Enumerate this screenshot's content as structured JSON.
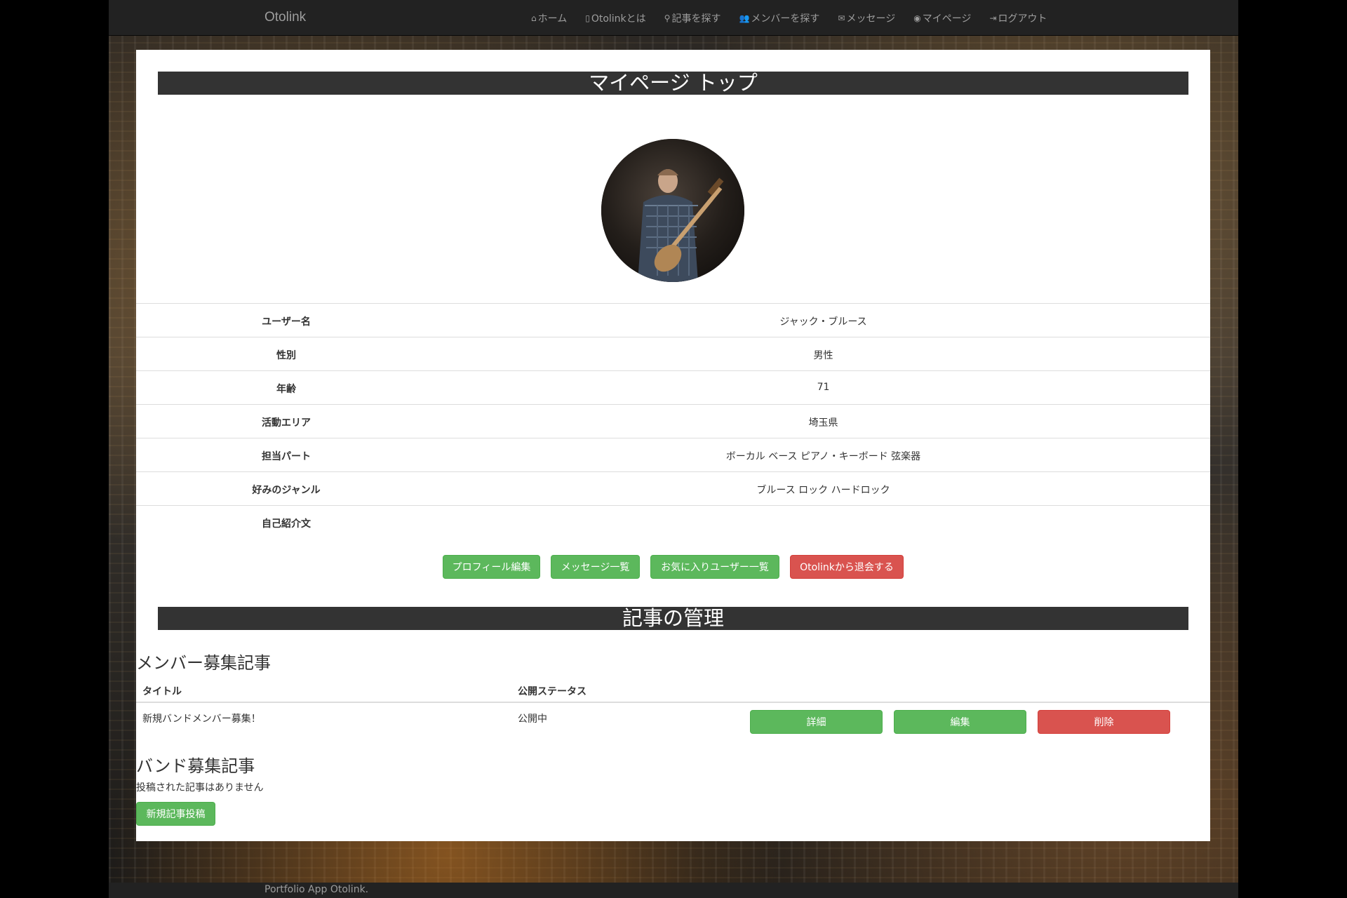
{
  "navbar": {
    "brand": "Otolink",
    "items": [
      {
        "icon": "home-icon",
        "glyph": "⌂",
        "label": "ホーム"
      },
      {
        "icon": "file-icon",
        "glyph": "▯",
        "label": "Otolinkとは"
      },
      {
        "icon": "search-icon",
        "glyph": "⚲",
        "label": "記事を探す"
      },
      {
        "icon": "users-icon",
        "glyph": "👥",
        "label": "メンバーを探す"
      },
      {
        "icon": "envelope-icon",
        "glyph": "✉",
        "label": "メッセージ"
      },
      {
        "icon": "user-circle-icon",
        "glyph": "◉",
        "label": "マイページ"
      },
      {
        "icon": "logout-icon",
        "glyph": "⇥",
        "label": "ログアウト"
      }
    ]
  },
  "mypage": {
    "title": "マイページ トップ",
    "avatar_icon": "user-photo-bass-player",
    "profile": [
      {
        "key": "ユーザー名",
        "value": "ジャック・ブルース"
      },
      {
        "key": "性別",
        "value": "男性"
      },
      {
        "key": "年齢",
        "value": "71"
      },
      {
        "key": "活動エリア",
        "value": "埼玉県"
      },
      {
        "key": "担当パート",
        "value": "ボーカル ベース ピアノ・キーボード 弦楽器"
      },
      {
        "key": "好みのジャンル",
        "value": "ブルース ロック ハードロック"
      },
      {
        "key": "自己紹介文",
        "value": ""
      }
    ],
    "buttons": {
      "edit_profile": "プロフィール編集",
      "messages": "メッセージ一覧",
      "favorites": "お気に入りユーザー一覧",
      "withdraw": "Otolinkから退会する"
    }
  },
  "articles": {
    "title": "記事の管理",
    "member_heading": "メンバー募集記事",
    "columns": {
      "title": "タイトル",
      "status": "公開ステータス"
    },
    "rows": [
      {
        "title": "新規バンドメンバー募集！",
        "status": "公開中",
        "detail": "詳細",
        "edit": "編集",
        "delete": "削除"
      }
    ],
    "band_heading": "バンド募集記事",
    "band_empty": "投稿された記事はありません",
    "new_post": "新規記事投稿"
  },
  "footer": {
    "text": "Portfolio App Otolink."
  },
  "colors": {
    "success": "#5cb85c",
    "danger": "#d9534f",
    "navbar": "#222222",
    "title_bar": "#333333"
  }
}
